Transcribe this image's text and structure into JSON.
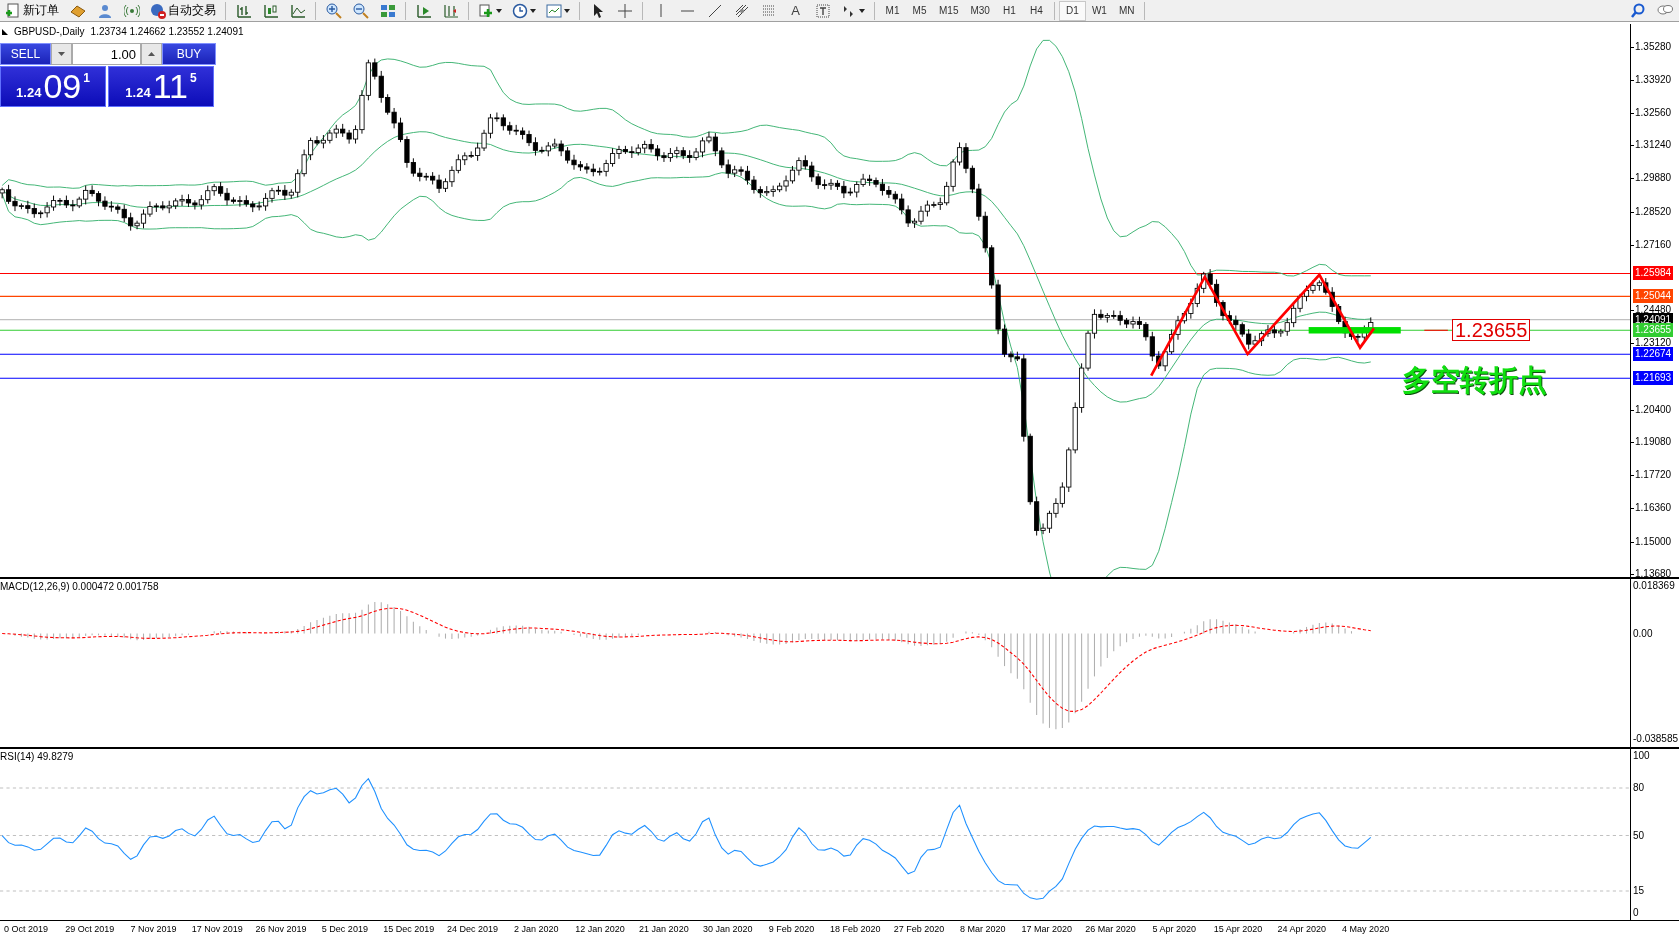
{
  "toolbar": {
    "buttons": [
      {
        "label": "新订单"
      },
      {
        "label": "自动交易"
      }
    ],
    "text_tool": "A",
    "timeframes": [
      {
        "label": "M1",
        "selected": false
      },
      {
        "label": "M5",
        "selected": false
      },
      {
        "label": "M15",
        "selected": false
      },
      {
        "label": "M30",
        "selected": false
      },
      {
        "label": "H1",
        "selected": false
      },
      {
        "label": "H4",
        "selected": false
      },
      {
        "label": "D1",
        "selected": true
      },
      {
        "label": "W1",
        "selected": false
      },
      {
        "label": "MN",
        "selected": false
      }
    ]
  },
  "chart": {
    "header": {
      "symbol": "GBPUSD-,Daily",
      "values": "1.23734 1.24662 1.23552 1.24091"
    },
    "trade_panel": {
      "sell": "SELL",
      "buy": "BUY",
      "lot": "1.00",
      "bid": {
        "prefix": "1.24",
        "big": "09",
        "sup": "1"
      },
      "ask": {
        "prefix": "1.24",
        "big": "11",
        "sup": "5"
      }
    },
    "price_axis": [
      "1.35280",
      "1.33920",
      "1.32560",
      "1.31240",
      "1.29880",
      "1.28520",
      "1.27160",
      "1.24480",
      "1.23120",
      "1.20400",
      "1.19080",
      "1.17720",
      "1.16360",
      "1.15000",
      "1.13680"
    ],
    "price_lines": [
      {
        "label": "1.25984",
        "color": "#ff0000",
        "kind": "level"
      },
      {
        "label": "1.25044",
        "color": "#ff4500",
        "kind": "level"
      },
      {
        "label": "1.24091",
        "color": "#000000",
        "kind": "bid"
      },
      {
        "label": "1.23655",
        "color": "#32cd32",
        "kind": "level"
      },
      {
        "label": "1.22674",
        "color": "#0000ff",
        "kind": "level"
      },
      {
        "label": "1.21693",
        "color": "#0000ff",
        "kind": "level"
      }
    ],
    "annotation_price": "1.23655",
    "annotation_text": "多空转折点"
  },
  "macd": {
    "label": "MACD(12,26,9) 0.000472 0.001758",
    "axis": [
      "0.018369",
      "0.00",
      "-0.038585"
    ]
  },
  "rsi": {
    "label": "RSI(14) 49.8279",
    "axis": [
      "100",
      "80",
      "50",
      "15",
      "0"
    ]
  },
  "date_axis": [
    "0 Oct 2019",
    "29 Oct 2019",
    "7 Nov 2019",
    "17 Nov 2019",
    "26 Nov 2019",
    "5 Dec 2019",
    "15 Dec 2019",
    "24 Dec 2019",
    "2 Jan 2020",
    "12 Jan 2020",
    "21 Jan 2020",
    "30 Jan 2020",
    "9 Feb 2020",
    "18 Feb 2020",
    "27 Feb 2020",
    "8 Mar 2020",
    "17 Mar 2020",
    "26 Mar 2020",
    "5 Apr 2020",
    "15 Apr 2020",
    "24 Apr 2020",
    "4 May 2020"
  ]
}
